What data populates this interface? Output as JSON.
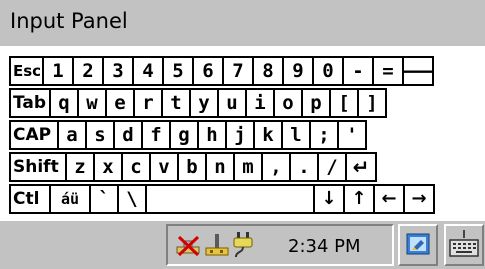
{
  "window": {
    "title": "Input Panel"
  },
  "keyboard": {
    "row1": [
      "Esc",
      "1",
      "2",
      "3",
      "4",
      "5",
      "6",
      "7",
      "8",
      "9",
      "0",
      "-",
      "=",
      "🡐"
    ],
    "row2": [
      "Tab",
      "q",
      "w",
      "e",
      "r",
      "t",
      "y",
      "u",
      "i",
      "o",
      "p",
      "[",
      "]"
    ],
    "row3": [
      "CAP",
      "a",
      "s",
      "d",
      "f",
      "g",
      "h",
      "j",
      "k",
      "l",
      ";",
      "'"
    ],
    "row4": [
      "Shift",
      "z",
      "x",
      "c",
      "v",
      "b",
      "n",
      "m",
      ",",
      ".",
      "/",
      "↵"
    ],
    "row5": [
      "Ctl",
      "áü",
      "`",
      "\\",
      "↓",
      "↑",
      "←",
      "→"
    ]
  },
  "taskbar": {
    "clock": "2:34 PM",
    "tray_icons": [
      "network-disconnected-icon",
      "usb-device-icon",
      "power-plug-icon"
    ],
    "ime_icon": "input-method-icon",
    "keyboard_icon": "keyboard-icon"
  }
}
